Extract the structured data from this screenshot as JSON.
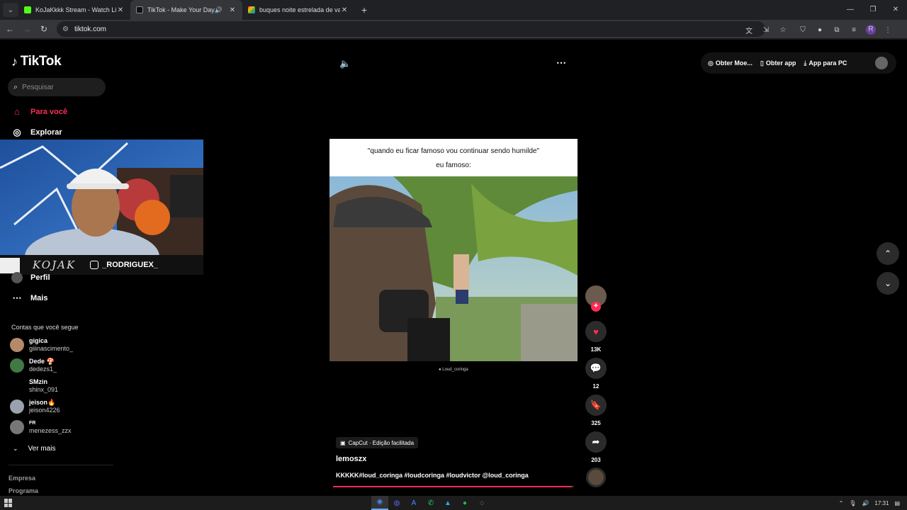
{
  "browser": {
    "tabs": [
      {
        "title": "KoJaKkkk Stream - Watch Live o",
        "active": false,
        "favicon_color": "#53fc18"
      },
      {
        "title": "TikTok - Make Your Day",
        "active": true,
        "favicon_color": "#000000"
      },
      {
        "title": "buques noite estrelada de van",
        "active": false,
        "favicon_color": "#4285f4"
      }
    ],
    "url": "tiktok.com",
    "profile_initial": "R"
  },
  "tiktok": {
    "logo": "TikTok",
    "search_placeholder": "Pesquisar",
    "nav": {
      "for_you": "Para você",
      "explore": "Explorar",
      "profile": "Perfil",
      "more": "Mais"
    },
    "following_title": "Contas que você segue",
    "following": [
      {
        "name": "gigica",
        "handle": "giiinascimento_",
        "color": "#b58a6a"
      },
      {
        "name": "Dede 🍄",
        "handle": "dedezs1_",
        "color": "#3f7a44"
      },
      {
        "name": "SMzin",
        "handle": "shinx_091",
        "color": "#000000"
      },
      {
        "name": "jeison🔥",
        "handle": "jeison4226",
        "color": "#9aa3ad"
      },
      {
        "name": "FR",
        "handle": "menezess_zzx",
        "color": "#777777"
      }
    ],
    "see_more": "Ver mais",
    "footer": [
      "Empresa",
      "Programa"
    ],
    "top_right": {
      "coins": "Obter Moe...",
      "app": "Obter app",
      "pc": "App para PC"
    },
    "video": {
      "caption_line1": "\"quando eu ficar famoso vou continuar sendo humilde\"",
      "caption_line2": "eu famoso:",
      "watermark": "Loud_coringa",
      "capcut": "CapCut · Edição facilitada",
      "author": "lemoszx",
      "description": "KKKKK#loud_coringa #loudcoringa #loudvictor @loud_coringa",
      "progress": 0.99
    },
    "actions": {
      "likes": "13K",
      "comments": "12",
      "saves": "325",
      "shares": "203"
    }
  },
  "stream_overlay": {
    "logo_text": "KOJAK",
    "instagram": "_RODRIGUEX_"
  },
  "taskbar": {
    "time": "17:31"
  }
}
